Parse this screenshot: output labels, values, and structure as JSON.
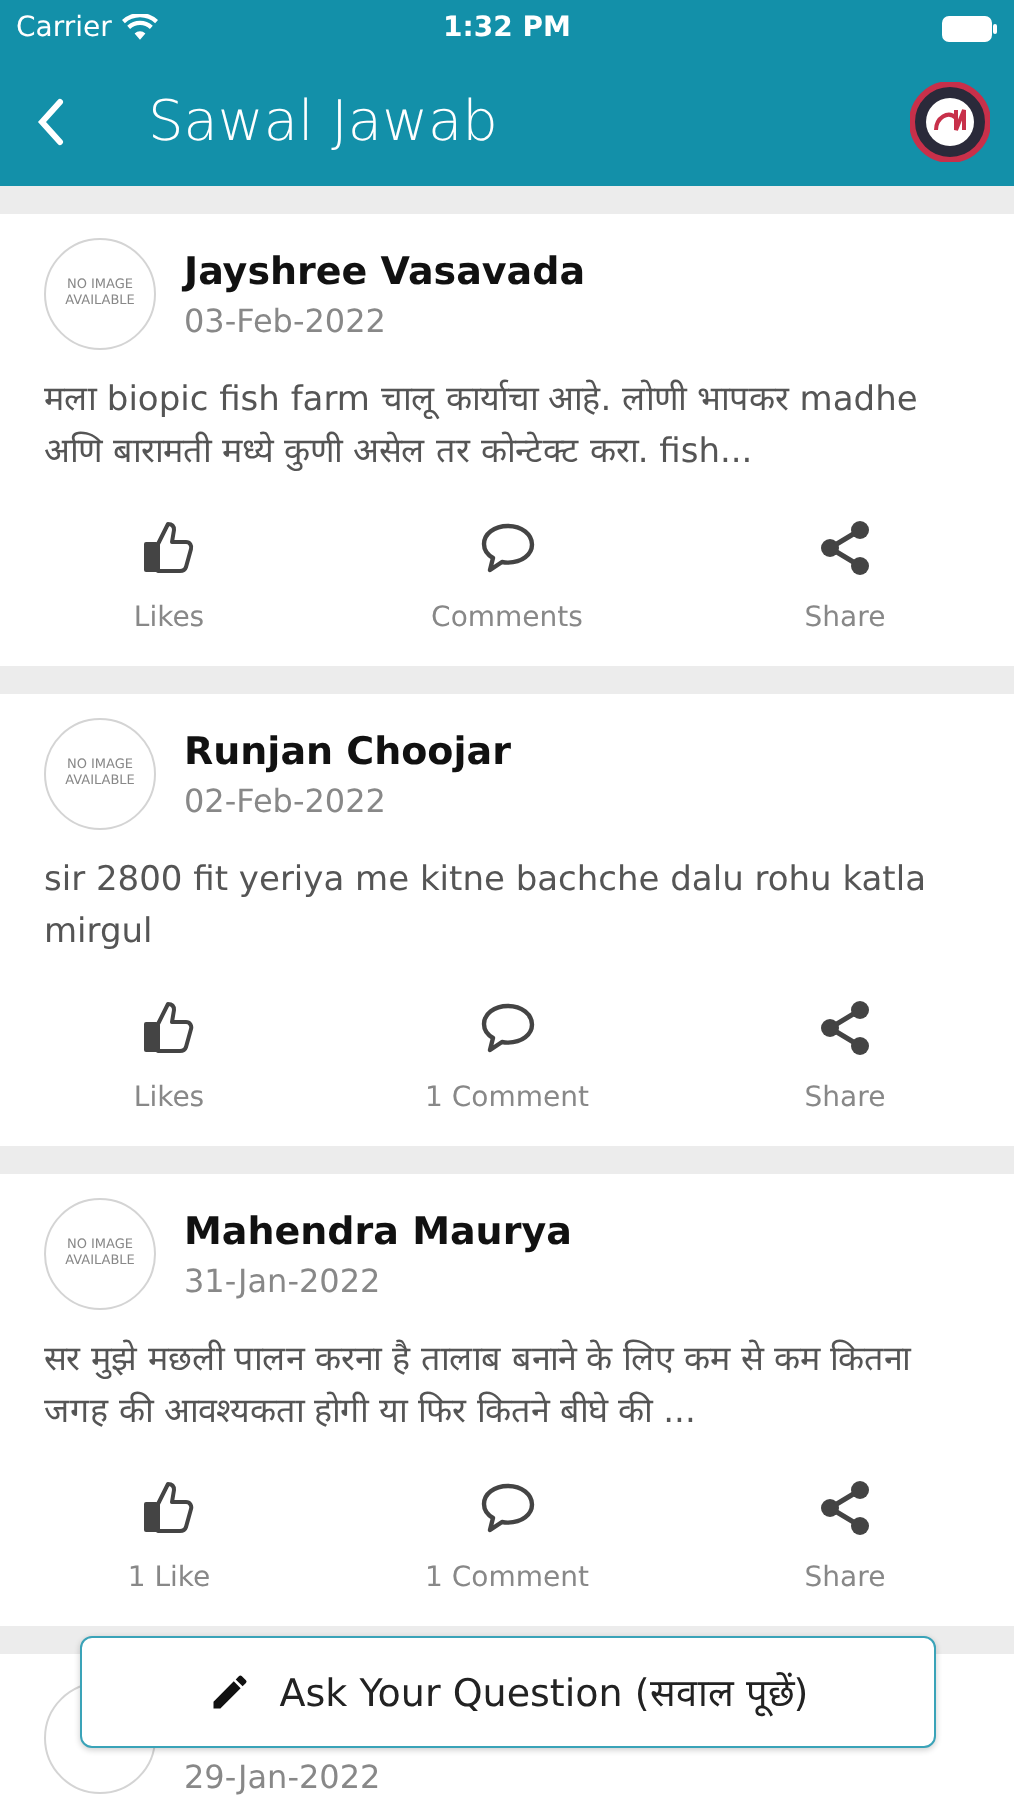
{
  "status_bar": {
    "carrier": "Carrier",
    "time": "1:32 PM"
  },
  "header": {
    "title": "Sawal Jawab"
  },
  "posts": [
    {
      "author": "Jayshree Vasavada",
      "date": "03-Feb-2022",
      "avatar_text": "NO IMAGE AVAILABLE",
      "text": "मला biopic fish farm चालू कार्याचा आहे. लोणी भापकर madhe अणि बारामती मध्ये कुणी असेल तर कोन्टेक्ट करा. fish...",
      "actions": [
        {
          "kind": "like",
          "label": "Likes"
        },
        {
          "kind": "comment",
          "label": "Comments"
        },
        {
          "kind": "share",
          "label": "Share"
        }
      ]
    },
    {
      "author": "Runjan Choojar",
      "date": "02-Feb-2022",
      "avatar_text": "NO IMAGE AVAILABLE",
      "text": "sir 2800 fit yeriya me kitne bachche dalu rohu katla mirgul",
      "actions": [
        {
          "kind": "like",
          "label": "Likes"
        },
        {
          "kind": "comment",
          "label": "1 Comment"
        },
        {
          "kind": "share",
          "label": "Share"
        }
      ]
    },
    {
      "author": "Mahendra Maurya",
      "date": "31-Jan-2022",
      "avatar_text": "NO IMAGE AVAILABLE",
      "text": "सर मुझे मछली पालन करना है तालाब बनाने के लिए कम से कम कितना  जगह की आवश्यकता होगी या फिर कितने बीघे की ...",
      "actions": [
        {
          "kind": "like",
          "label": "1 Like"
        },
        {
          "kind": "comment",
          "label": "1 Comment"
        },
        {
          "kind": "share",
          "label": "Share"
        }
      ]
    },
    {
      "date": "29-Jan-2022"
    }
  ],
  "ask_button": {
    "label": "Ask Your Question (सवाल पूछें)"
  }
}
